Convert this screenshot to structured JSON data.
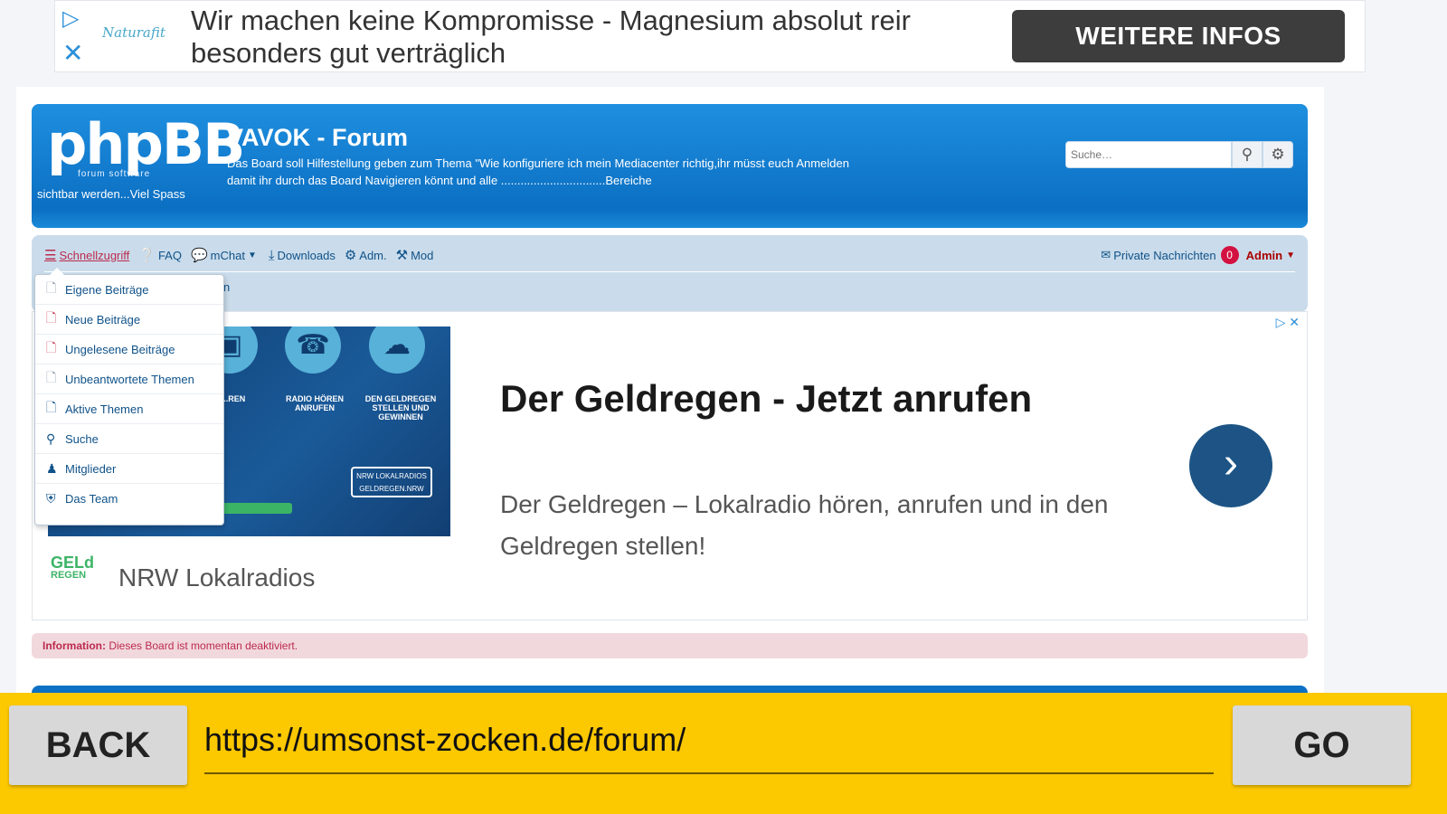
{
  "top_ad": {
    "brand": "Naturafit",
    "text_line1": "Wir machen keine Kompromisse - Magnesium absolut reir",
    "text_line2": "besonders gut verträglich",
    "cta": "WEITERE INFOS",
    "icons": [
      "adchoices-play-icon",
      "close-icon"
    ]
  },
  "header": {
    "logo": "phpBB",
    "logo_sub": "forum   software",
    "title": "VAVOK - Forum",
    "description": "Das Board soll Hilfestellung geben zum Thema \"Wie konfiguriere ich mein Mediacenter richtig,ihr müsst euch Anmelden damit ihr durch das Board Navigieren könnt und alle ................................Bereiche",
    "description_cont": "sichtbar werden...Viel Spass",
    "search_placeholder": "Suche…"
  },
  "navbar": {
    "items": [
      {
        "label": "Schnellzugriff",
        "icon": "menu-icon"
      },
      {
        "label": "FAQ",
        "icon": "question-icon"
      },
      {
        "label": "mChat",
        "icon": "chat-icon"
      },
      {
        "label": "Downloads",
        "icon": "download-icon"
      },
      {
        "label": "Adm.",
        "icon": "gears-icon"
      },
      {
        "label": "Mod",
        "icon": "gavel-icon"
      }
    ],
    "private_messages": "Private Nachrichten",
    "pm_count": "0",
    "user": "Admin",
    "crumb_fragment": "n"
  },
  "dropdown": {
    "items": [
      {
        "label": "Eigene Beiträge",
        "icon": "file-icon"
      },
      {
        "label": "Neue Beiträge",
        "icon": "file-red-icon"
      },
      {
        "label": "Ungelesene Beiträge",
        "icon": "file-red-icon"
      },
      {
        "label": "Unbeantwortete Themen",
        "icon": "file-icon"
      },
      {
        "label": "Aktive Themen",
        "icon": "file-blue-icon"
      },
      {
        "label": "Suche",
        "icon": "search-icon"
      },
      {
        "label": "Mitglieder",
        "icon": "group-icon"
      },
      {
        "label": "Das Team",
        "icon": "shield-icon"
      }
    ]
  },
  "ad": {
    "headline": "Der Geldregen - Jetzt anrufen",
    "body": "Der Geldregen – Lokalradio hören, anrufen und in den Geldregen stellen!",
    "brand_name": "NRW Lokalradios",
    "brand_logo_top": "GELd",
    "brand_logo_bottom": "REGEN",
    "image_captions": [
      "...REN",
      "RADIO HÖREN ANRUFEN",
      "DEN GELDREGEN STELLEN UND GEWINNEN"
    ],
    "image_box": "NRW LOKALRADIOS",
    "image_box_sub": "GELDREGEN.NRW"
  },
  "info": {
    "label": "Information:",
    "text": "Dieses Board ist momentan deaktiviert."
  },
  "bottom_bar": {
    "back": "BACK",
    "url": "https://umsonst-zocken.de/forum/",
    "go": "GO"
  },
  "colors": {
    "header_blue": "#0b6fc2",
    "navbar_bg": "#cadceb",
    "bottom_bar": "#fcc800",
    "info_bg": "#f1d8dd",
    "ad_arrow": "#1d5485"
  }
}
